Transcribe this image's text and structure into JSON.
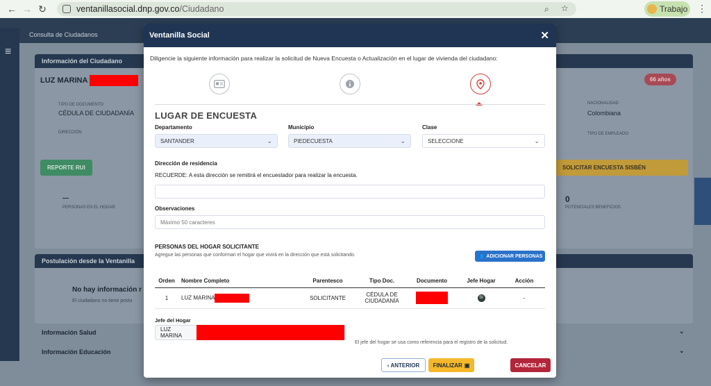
{
  "browser": {
    "url_host": "ventanillasocial.dnp.gov.co",
    "url_path": "/Ciudadano",
    "profile_label": "Trabajo"
  },
  "background": {
    "topbar_title": "Consulta de Ciudadanos",
    "panel_title": "Información del Ciudadano",
    "citizen_name": "LUZ MARINA",
    "doc_type_label": "TIPO DE DOCUMENTO",
    "doc_type_value": "CÉDULA DE CIUDADANÍA",
    "address_label": "DIRECCIÓN",
    "nationality_label": "NACIONALIDAD",
    "nationality_value": "Colombiana",
    "employee_type_label": "TIPO DE EMPLEADO",
    "age_badge": "66 años",
    "report_button": "REPORTE RUI",
    "survey_button": "SOLICITAR ENCUESTA SISBÉN",
    "household_count": "—",
    "household_label": "PERSONAS EN EL HOGAR",
    "benefits_count": "0",
    "benefits_label": "POTENCIALES BENEFICIOS",
    "postulation_title": "Postulación desde la Ventanilla",
    "no_info_title": "No hay información r",
    "no_info_text": "El ciudadano no tiene postu",
    "accordion_health": "Información Salud",
    "accordion_education": "Información Educación"
  },
  "modal": {
    "title": "Ventanilla Social",
    "close_glyph": "✕",
    "intro": "Diligencie la siguiente información para realizar la solicitud de Nueva Encuesta o Actualización en el lugar de vivienda del ciudadano:",
    "section_title": "LUGAR DE ENCUESTA",
    "departamento": {
      "label": "Departamento",
      "value": "SANTANDER"
    },
    "municipio": {
      "label": "Municipio",
      "value": "PIEDECUESTA"
    },
    "clase": {
      "label": "Clase",
      "value": "SELECCIONE"
    },
    "direccion_label": "Dirección de residencia",
    "recuerde": "RECUERDE: A esta dirección se remitirá el encuestador para realizar la encuesta.",
    "direccion_value": "",
    "observaciones_label": "Observaciones",
    "observaciones_placeholder": "Máximo 50 caracteres",
    "personas_title": "PERSONAS DEL HOGAR SOLICITANTE",
    "personas_help": "Agregue las personas que conforman el hogar que vivirá en la dirección que está solicitando.",
    "add_button": "ADICIONAR PERSONAS",
    "table": {
      "headers": [
        "Orden",
        "Nombre Completo",
        "Parentesco",
        "Tipo Doc.",
        "Documento",
        "Jefe Hogar",
        "Acción"
      ],
      "rows": [
        {
          "orden": "1",
          "nombre": "LUZ MARINA",
          "parentesco": "SOLICITANTE",
          "tipo_doc_1": "CÉDULA DE",
          "tipo_doc_2": "CIUDADANÍA",
          "jefe": "SI",
          "accion": "-"
        }
      ]
    },
    "jefe_label": "Jefe del Hogar",
    "jefe_value": "LUZ MARINA",
    "jefe_note": "El jefe del hogar se usa como referencia para el registro de la solicitud.",
    "btn_anterior": "ANTERIOR",
    "btn_finalizar": "FINALIZAR",
    "btn_cancelar": "CANCELAR"
  },
  "colors": {
    "header": "#1f3553",
    "accent_red": "#d63b3b",
    "primary_blue": "#2a72c9",
    "warning_yellow": "#f4b82a",
    "danger": "#b3263a"
  }
}
